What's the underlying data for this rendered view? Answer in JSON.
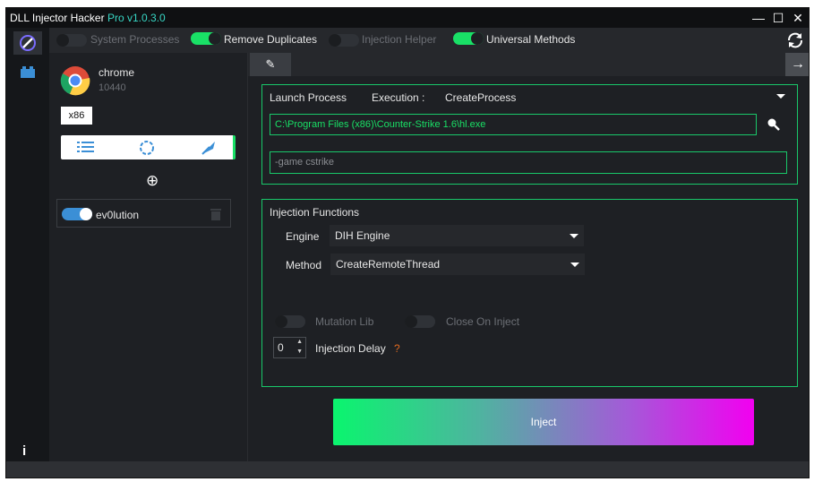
{
  "titlebar": {
    "title": "DLL Injector Hacker",
    "version": "Pro v1.0.3.0",
    "minimize": "—",
    "maximize": "☐",
    "close": "✕",
    "accent": "#37d6c4"
  },
  "toolbar": {
    "system_processes": "System Processes",
    "remove_duplicates": "Remove Duplicates",
    "injection_helper": "Injection Helper",
    "universal_methods": "Universal Methods",
    "refresh_icon": "refresh-icon"
  },
  "toggles_state": {
    "system_processes": false,
    "remove_duplicates": true,
    "injection_helper": false,
    "universal_methods": true
  },
  "process": {
    "name": "chrome",
    "pid": "10440",
    "arch": "x86"
  },
  "sidebar": {
    "add_icon": "⊕",
    "dll_item": {
      "name": "ev0lution",
      "enabled": true
    }
  },
  "tabs": {
    "active_tab_icon": "✎",
    "next_icon": "→"
  },
  "launch": {
    "label": "Launch Process",
    "execution_label": "Execution :",
    "execution_value": "CreateProcess",
    "path": "C:\\Program Files (x86)\\Counter-Strike 1.6\\hl.exe",
    "args": "-game cstrike"
  },
  "functions": {
    "label": "Injection Functions",
    "engine_label": "Engine",
    "engine_value": "DIH Engine",
    "method_label": "Method",
    "method_value": "CreateRemoteThread",
    "mutation_lib": "Mutation Lib",
    "close_on_inject": "Close On Inject",
    "delay_value": "0",
    "delay_label": "Injection Delay",
    "help_mark": "?"
  },
  "actions": {
    "inject": "Inject"
  },
  "colors": {
    "green": "#19e066",
    "border_green": "#19c86a",
    "background": "#1e2024",
    "gradient_start": "#0af56e",
    "gradient_end": "#f200f0"
  }
}
